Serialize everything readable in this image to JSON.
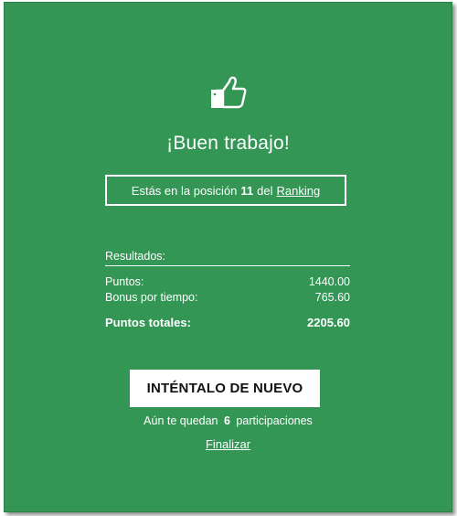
{
  "icon": "thumbs-up-icon",
  "headline": "¡Buen trabajo!",
  "ranking": {
    "prefix": "Estás en la posición",
    "position": "11",
    "middle": "del",
    "link_label": "Ranking"
  },
  "results": {
    "title": "Resultados:",
    "rows": [
      {
        "label": "Puntos:",
        "value": "1440.00"
      },
      {
        "label": "Bonus por tiempo:",
        "value": "765.60"
      }
    ],
    "total": {
      "label": "Puntos totales:",
      "value": "2205.60"
    }
  },
  "retry_label": "INTÉNTALO DE NUEVO",
  "remaining": {
    "prefix": "Aún te quedan",
    "count": "6",
    "suffix": "participaciones"
  },
  "finish_label": "Finalizar",
  "colors": {
    "background": "#349655",
    "text": "#ffffff",
    "button_bg": "#ffffff",
    "button_text": "#111111"
  }
}
